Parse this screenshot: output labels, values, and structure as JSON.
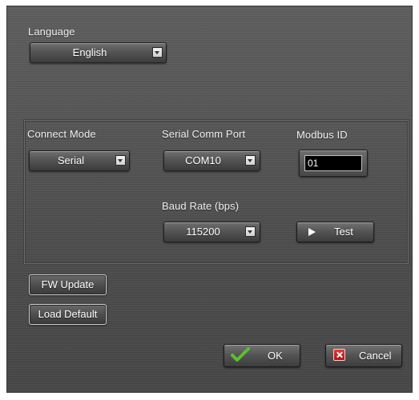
{
  "language": {
    "label": "Language",
    "value": "English"
  },
  "connection": {
    "connect_mode_label": "Connect Mode",
    "connect_mode_value": "Serial",
    "serial_port_label": "Serial Comm Port",
    "serial_port_value": "COM10",
    "modbus_id_label": "Modbus ID",
    "modbus_id_value": "01",
    "baud_rate_label": "Baud Rate (bps)",
    "baud_rate_value": "115200",
    "test_label": "Test"
  },
  "actions": {
    "fw_update_label": "FW Update",
    "load_default_label": "Load Default",
    "ok_label": "OK",
    "cancel_label": "Cancel"
  },
  "colors": {
    "panel": "#555555",
    "ok_check": "#5cc02a",
    "cancel_box": "#d22020"
  },
  "icons": [
    "dropdown-arrow-icon",
    "play-icon",
    "checkmark-icon",
    "close-x-icon"
  ]
}
